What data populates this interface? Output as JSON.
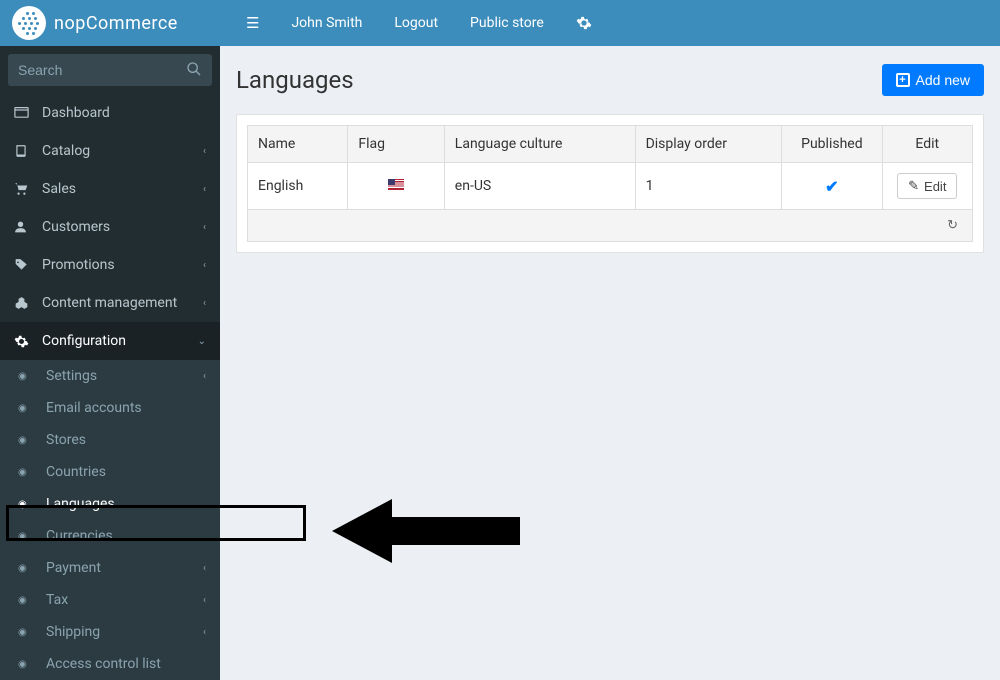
{
  "brand": "nopCommerce",
  "topbar": {
    "user": "John Smith",
    "logout": "Logout",
    "public_store": "Public store"
  },
  "search": {
    "placeholder": "Search"
  },
  "nav": {
    "dashboard": "Dashboard",
    "catalog": "Catalog",
    "sales": "Sales",
    "customers": "Customers",
    "promotions": "Promotions",
    "content": "Content management",
    "configuration": "Configuration"
  },
  "config_sub": {
    "settings": "Settings",
    "email": "Email accounts",
    "stores": "Stores",
    "countries": "Countries",
    "languages": "Languages",
    "currencies": "Currencies",
    "payment": "Payment",
    "tax": "Tax",
    "shipping": "Shipping",
    "acl": "Access control list"
  },
  "page": {
    "title": "Languages",
    "add_new": "Add new"
  },
  "table": {
    "headers": {
      "name": "Name",
      "flag": "Flag",
      "culture": "Language culture",
      "order": "Display order",
      "published": "Published",
      "edit": "Edit"
    },
    "rows": [
      {
        "name": "English",
        "culture": "en-US",
        "order": "1",
        "published": true,
        "edit_label": "Edit"
      }
    ]
  }
}
